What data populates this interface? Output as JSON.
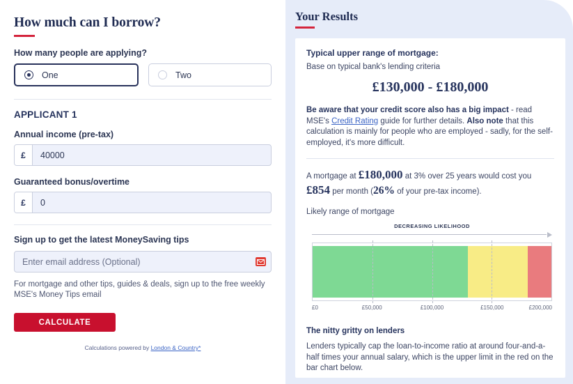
{
  "form": {
    "title": "How much can I borrow?",
    "applicants_question": "How many people are applying?",
    "options": [
      {
        "label": "One",
        "selected": true
      },
      {
        "label": "Two",
        "selected": false
      }
    ],
    "applicant_heading": "APPLICANT 1",
    "income_label": "Annual income (pre-tax)",
    "income_currency": "£",
    "income_value": "40000",
    "bonus_label": "Guaranteed bonus/overtime",
    "bonus_currency": "£",
    "bonus_value": "0",
    "signup_label": "Sign up to get the latest MoneySaving tips",
    "email_placeholder": "Enter email address (Optional)",
    "email_value": "",
    "signup_note": "For mortgage and other tips, guides & deals, sign up to the free weekly MSE's Money Tips email",
    "calculate_label": "CALCULATE",
    "powered_prefix": "Calculations powered by ",
    "powered_link": "London & Country*",
    "accent_red": "#c8102e",
    "accent_navy": "#26335d"
  },
  "results": {
    "title": "Your Results",
    "upper_range_heading": "Typical upper range of mortgage:",
    "upper_range_sub": "Base on typical bank's lending criteria",
    "range_value": "£130,000 - £180,000",
    "credit_para_bold": "Be aware that your credit score also has a big impact",
    "credit_para_mid": " - read MSE's ",
    "credit_link": "Credit Rating",
    "credit_para_after_link": " guide for further details. ",
    "credit_also_note": "Also note",
    "credit_para_tail": " that this calculation is mainly for people who are employed - sadly, for the self-employed, it's more difficult.",
    "mortgage_pre": "A mortgage at ",
    "mortgage_amount": "£180,000",
    "mortgage_mid": " at 3% over 25 years would cost you ",
    "monthly_amount": "£854",
    "monthly_mid": " per month (",
    "percent_value": "26%",
    "monthly_tail": " of your pre-tax income).",
    "likely_range_label": "Likely range of mortgage",
    "nitty_heading": "The nitty gritty on lenders",
    "nitty_para": "Lenders typically cap the loan-to-income ratio at around four-and-a-half times your annual salary, which is the upper limit in the red on the bar chart below."
  },
  "chart_data": {
    "type": "bar",
    "title": "DECREASING LIKELIHOOD",
    "xlabel": "",
    "ylabel": "",
    "xlim": [
      0,
      200000
    ],
    "grid": true,
    "legend": false,
    "tick_labels": [
      "£0",
      "£50,000",
      "£100,000",
      "£150,000",
      "£200,000"
    ],
    "tick_values": [
      0,
      50000,
      100000,
      150000,
      200000
    ],
    "bands": [
      {
        "name": "likely",
        "start": 0,
        "end": 130000,
        "color": "#7ed994"
      },
      {
        "name": "possible",
        "start": 130000,
        "end": 180000,
        "color": "#f8ec86"
      },
      {
        "name": "unlikely",
        "start": 180000,
        "end": 200000,
        "color": "#e97b7e"
      }
    ]
  }
}
